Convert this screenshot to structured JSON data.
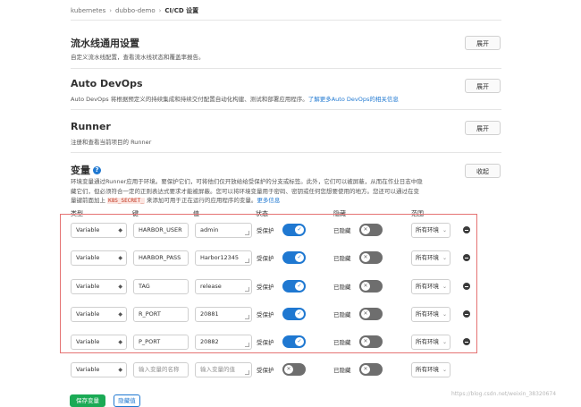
{
  "breadcrumb": [
    "kubernetes",
    "dubbo-demo",
    "CI/CD 设置"
  ],
  "pipeline": {
    "title": "流水线通用设置",
    "desc": "自定义流水线配置，查看流水线状态和覆盖率报告。",
    "button": "展开"
  },
  "devops": {
    "title": "Auto DevOps",
    "desc": "Auto DevOps 将根据预定义的持续集成和持续交付配置自动化构建、测试和部署应用程序。",
    "link": "了解更多Auto DevOps的相关信息",
    "button": "展开"
  },
  "runner": {
    "title": "Runner",
    "desc": "注册和查看当前项目的 Runner",
    "button": "展开"
  },
  "variables": {
    "title": "变量",
    "help_icon": "question-circle-icon",
    "button": "收起",
    "desc_line1": "环境变量通过Runner应用于环境。要保护它们，可将他们仅开放给给受保护的分支或标签。此外，它们可以被屏蔽，从而在作业日志中隐",
    "desc_line2": "藏它们，但必须符合一定的正则表达式要求才能被屏蔽。您可以将环境变量用于密码、密钥或任何您想要使用的地方。您还可以通过在变",
    "desc_line3_prefix": "量键前面加上",
    "desc_code": "K8S_SECRET_",
    "desc_line3_suffix": "来添加可用于正在运行的应用程序的变量。",
    "desc_link": "更多信息",
    "columns": {
      "type": "类型",
      "key": "键",
      "value": "值",
      "status": "状态",
      "masked": "隐藏",
      "scope": "范围"
    },
    "rows": [
      {
        "type": "Variable",
        "key": "HARBOR_USER",
        "value": "admin",
        "protected_label": "受保护",
        "masked_label": "已隐藏",
        "scope": "所有环境"
      },
      {
        "type": "Variable",
        "key": "HARBOR_PASS",
        "value": "Harbor12345",
        "protected_label": "受保护",
        "masked_label": "已隐藏",
        "scope": "所有环境"
      },
      {
        "type": "Variable",
        "key": "TAG",
        "value": "release",
        "protected_label": "受保护",
        "masked_label": "已隐藏",
        "scope": "所有环境"
      },
      {
        "type": "Variable",
        "key": "R_PORT",
        "value": "20881",
        "protected_label": "受保护",
        "masked_label": "已隐藏",
        "scope": "所有环境"
      },
      {
        "type": "Variable",
        "key": "P_PORT",
        "value": "20882",
        "protected_label": "受保护",
        "masked_label": "已隐藏",
        "scope": "所有环境"
      }
    ],
    "new_row": {
      "type": "Variable",
      "key_placeholder": "输入变量的名称",
      "value_placeholder": "输入变量的值",
      "protected_label": "受保护",
      "masked_label": "已隐藏",
      "scope": "所有环境"
    },
    "save_button": "保存变量",
    "hide_values_button": "隐藏值"
  },
  "watermark": "https://blog.csdn.net/weixin_38320674",
  "colors": {
    "accent": "#1f78d1",
    "save": "#1aaa55",
    "highlight": "#e57373",
    "toggle_off": "#6e6e6e"
  }
}
